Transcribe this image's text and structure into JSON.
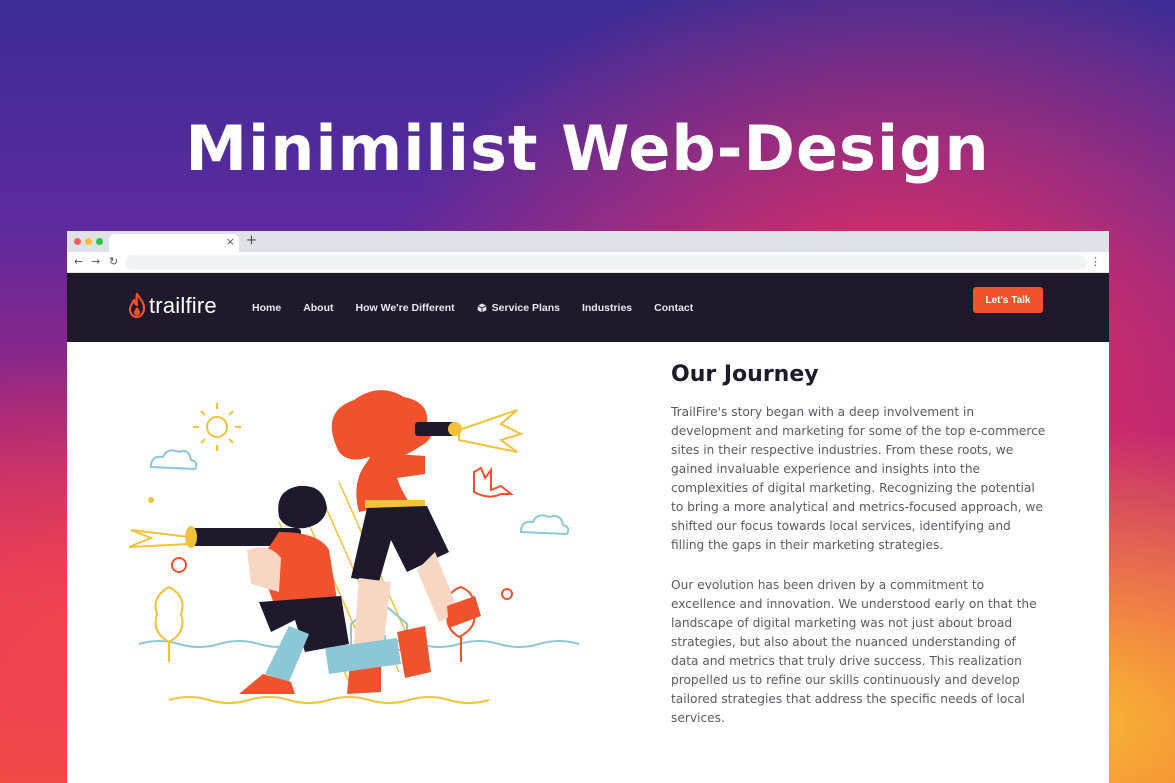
{
  "hero": {
    "title": "Minimilist Web-Design"
  },
  "browser": {
    "tab_close": "×",
    "new_tab": "+",
    "back": "←",
    "forward": "→",
    "reload": "↻",
    "menu": "⋮"
  },
  "site": {
    "logo_text": "trailfire",
    "nav": {
      "items": [
        {
          "label": "Home"
        },
        {
          "label": "About"
        },
        {
          "label": "How We're Different"
        },
        {
          "label": "Service Plans",
          "icon": "cube-icon"
        },
        {
          "label": "Industries"
        },
        {
          "label": "Contact"
        }
      ],
      "cta_label": "Let's Talk"
    },
    "section": {
      "title": "Our Journey",
      "paragraphs": [
        "TrailFire's story began with a deep involvement in development and marketing for some of the top e-commerce sites in their respective industries. From these roots, we gained invaluable experience and insights into the complexities of digital marketing. Recognizing the potential to bring a more analytical and metrics-focused approach, we shifted our focus towards local services, identifying and filling the gaps in their marketing strategies.",
        "Our evolution has been driven by a commitment to excellence and innovation. We understood early on that the landscape of digital marketing was not just about broad strategies, but also about the nuanced understanding of data and metrics that truly drive success. This realization propelled us to refine our skills continuously and develop tailored strategies that address the specific needs of local services."
      ]
    }
  },
  "colors": {
    "nav_bg": "#1f1a2b",
    "accent": "#f0522d",
    "heading": "#1f1a2b",
    "body_text": "#5a5a64"
  }
}
